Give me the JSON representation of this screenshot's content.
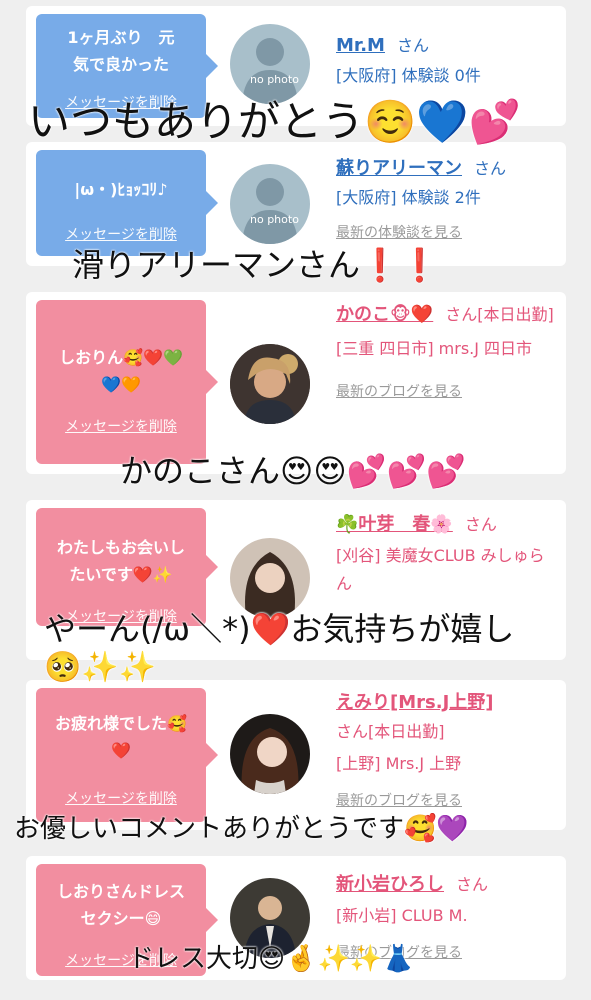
{
  "cards": [
    {
      "message": "1ヶ月ぶり　元気で良かった",
      "delete_label": "メッセージを削除",
      "name": "Mr.M",
      "honorific": "さん",
      "meta": "[大阪府] 体験談 0件",
      "more": "",
      "avatar_text": "no photo",
      "theme": "blue"
    },
    {
      "message": "|ω・)ﾋｮｯｺﾘ♪",
      "delete_label": "メッセージを削除",
      "name": "蘇りアリーマン",
      "honorific": "さん",
      "meta": "[大阪府] 体験談 2件",
      "more": "最新の体験談を見る",
      "avatar_text": "no photo",
      "theme": "blue"
    },
    {
      "message": "しおりん🥰❤️💚💙🧡",
      "delete_label": "メッセージを削除",
      "name": "かのこ🐵❤️",
      "honorific": "さん[本日出勤]",
      "meta": "[三重 四日市] mrs.J 四日市",
      "more": "最新のブログを見る",
      "theme": "pink"
    },
    {
      "message": "わたしもお会いしたいです❤️✨",
      "delete_label": "メッセージを削除",
      "name": "☘️叶芽　春🌸",
      "honorific": "さん",
      "meta": "[刈谷] 美魔女CLUB みしゅらん",
      "more": "",
      "theme": "pink"
    },
    {
      "message": "お疲れ様でした🥰❤️",
      "delete_label": "メッセージを削除",
      "name": "えみり[Mrs.J上野]",
      "honorific": "さん[本日出勤]",
      "meta": "[上野] Mrs.J 上野",
      "more": "最新のブログを見る",
      "theme": "pink"
    },
    {
      "message": "しおりさんドレスセクシー😄",
      "delete_label": "メッセージを削除",
      "name": "新小岩ひろし",
      "honorific": "さん",
      "meta": "[新小岩] CLUB M.",
      "more": "最新のブログを見る",
      "theme": "pink"
    }
  ],
  "overlays": {
    "o1": "いつもありがとう☺️💙💕",
    "o2": "滑りアリーマンさん❗️❗️",
    "o3": "かのこさん😍😍💕💕💕",
    "o4a": "やーん(/ω＼*)❤️お気持ちが嬉し",
    "o4b": "🥺✨✨",
    "o5": "お優しいコメントありがとうです🥰💜",
    "o6": "ドレス大切😍🤞✨✨👗"
  },
  "colors": {
    "blue_bubble": "#78abe8",
    "pink_bubble": "#f28ea0",
    "blue_text": "#2f6fbd",
    "pink_text": "#e3557a"
  }
}
